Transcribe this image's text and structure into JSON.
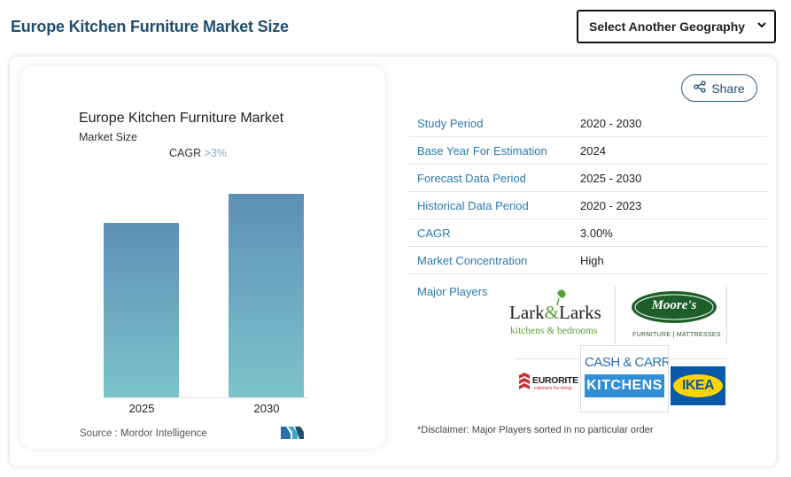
{
  "header": {
    "title": "Europe Kitchen Furniture Market Size",
    "geo_select": "Select Another Geography"
  },
  "chart": {
    "title": "Europe Kitchen Furniture Market",
    "subtitle": "Market Size",
    "cagr_label": "CAGR",
    "cagr_value": ">3%",
    "source": "Source : Mordor Intelligence"
  },
  "chart_data": {
    "type": "bar",
    "title": "Europe Kitchen Furniture Market",
    "categories": [
      "2025",
      "2030"
    ],
    "values": [
      182,
      212
    ],
    "ylim": [
      0,
      240
    ],
    "grid": false,
    "annotation": "CAGR >3%"
  },
  "share": {
    "label": "Share"
  },
  "info": {
    "rows": [
      {
        "key": "Study Period",
        "value": "2020 - 2030"
      },
      {
        "key": "Base Year For Estimation",
        "value": "2024"
      },
      {
        "key": "Forecast Data Period",
        "value": "2025 - 2030"
      },
      {
        "key": "Historical Data Period",
        "value": "2020 - 2023"
      },
      {
        "key": "CAGR",
        "value": "3.00%"
      },
      {
        "key": "Market Concentration",
        "value": "High"
      }
    ],
    "players_label": "Major Players",
    "disclaimer": "*Disclaimer: Major Players sorted in no particular order"
  },
  "logos": {
    "lark_1": "Lark",
    "lark_amp": "&",
    "lark_2": "Larks",
    "lark_sub": "kitchens & bedrooms",
    "moores": "Moore's",
    "moores_sub": "FURNITURE | MATTRESSES",
    "eurorite": "EURORITE",
    "eurorite_sub": "cabinets for living",
    "cashcarry_1": "CASH & CARRY",
    "cashcarry_2": "KITCHENS",
    "ikea": "IKEA"
  },
  "colors": {
    "brand_blue": "#1f4e6f",
    "link_blue": "#2b7ab0",
    "bar_top": "#5e8fb6",
    "bar_bottom": "#7cc3cb",
    "moores_green": "#1e5e2a",
    "ikea_blue": "#0a58a8",
    "ikea_yellow": "#ffd400"
  }
}
